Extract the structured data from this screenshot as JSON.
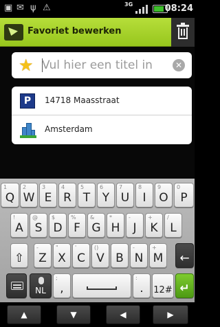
{
  "status_bar": {
    "icons": [
      "sim-icon",
      "mail-icon",
      "usb-icon",
      "warning-icon",
      "network-3g-icon",
      "signal-icon",
      "battery-icon"
    ],
    "network": "3G",
    "time": "08:24"
  },
  "action_bar": {
    "title": "Favoriet bewerken",
    "app_icon": "navigation-arrow-icon",
    "delete_icon": "trash-icon",
    "bg_color": "#a8d22b"
  },
  "title_field": {
    "placeholder": "Vul hier een titel in",
    "value": "",
    "star_icon": "star-icon",
    "clear_icon": "clear-x-icon"
  },
  "locations": [
    {
      "icon": "parking-icon",
      "icon_text": "P",
      "label": "14718 Maasstraat"
    },
    {
      "icon": "city-buildings-icon",
      "label": "Amsterdam"
    }
  ],
  "keyboard": {
    "row1": [
      {
        "main": "Q",
        "alt": "1"
      },
      {
        "main": "W",
        "alt": "2"
      },
      {
        "main": "E",
        "alt": "3"
      },
      {
        "main": "R",
        "alt": "4"
      },
      {
        "main": "T",
        "alt": "5"
      },
      {
        "main": "Y",
        "alt": "6"
      },
      {
        "main": "U",
        "alt": "7"
      },
      {
        "main": "I",
        "alt": "8"
      },
      {
        "main": "O",
        "alt": "9"
      },
      {
        "main": "P",
        "alt": "0"
      }
    ],
    "row2": [
      {
        "main": "A",
        "alt": "!"
      },
      {
        "main": "S",
        "alt": "@"
      },
      {
        "main": "D",
        "alt": "$"
      },
      {
        "main": "F",
        "alt": "%"
      },
      {
        "main": "G",
        "alt": "&"
      },
      {
        "main": "H",
        "alt": "*"
      },
      {
        "main": "J",
        "alt": "-"
      },
      {
        "main": "K",
        "alt": "+"
      },
      {
        "main": "L",
        "alt": "/"
      }
    ],
    "row3": [
      {
        "main": "Z",
        "alt": "-"
      },
      {
        "main": "X",
        "alt": "\""
      },
      {
        "main": "C",
        "alt": "'"
      },
      {
        "main": "V",
        "alt": "()"
      },
      {
        "main": "B",
        "alt": ""
      },
      {
        "main": "N",
        "alt": "-"
      },
      {
        "main": "M",
        "alt": "+"
      }
    ],
    "shift_label": "⇧",
    "backspace_label": "←",
    "mic_label": "NL",
    "comma_key": {
      "main": ",",
      "alt": ";"
    },
    "period_key": {
      "main": ".",
      "alt": ":"
    },
    "symbols_label": "12#",
    "enter_label": "↵"
  },
  "nav_bar": {
    "up": "▲",
    "down": "▼",
    "left": "◀",
    "right": "▶"
  }
}
